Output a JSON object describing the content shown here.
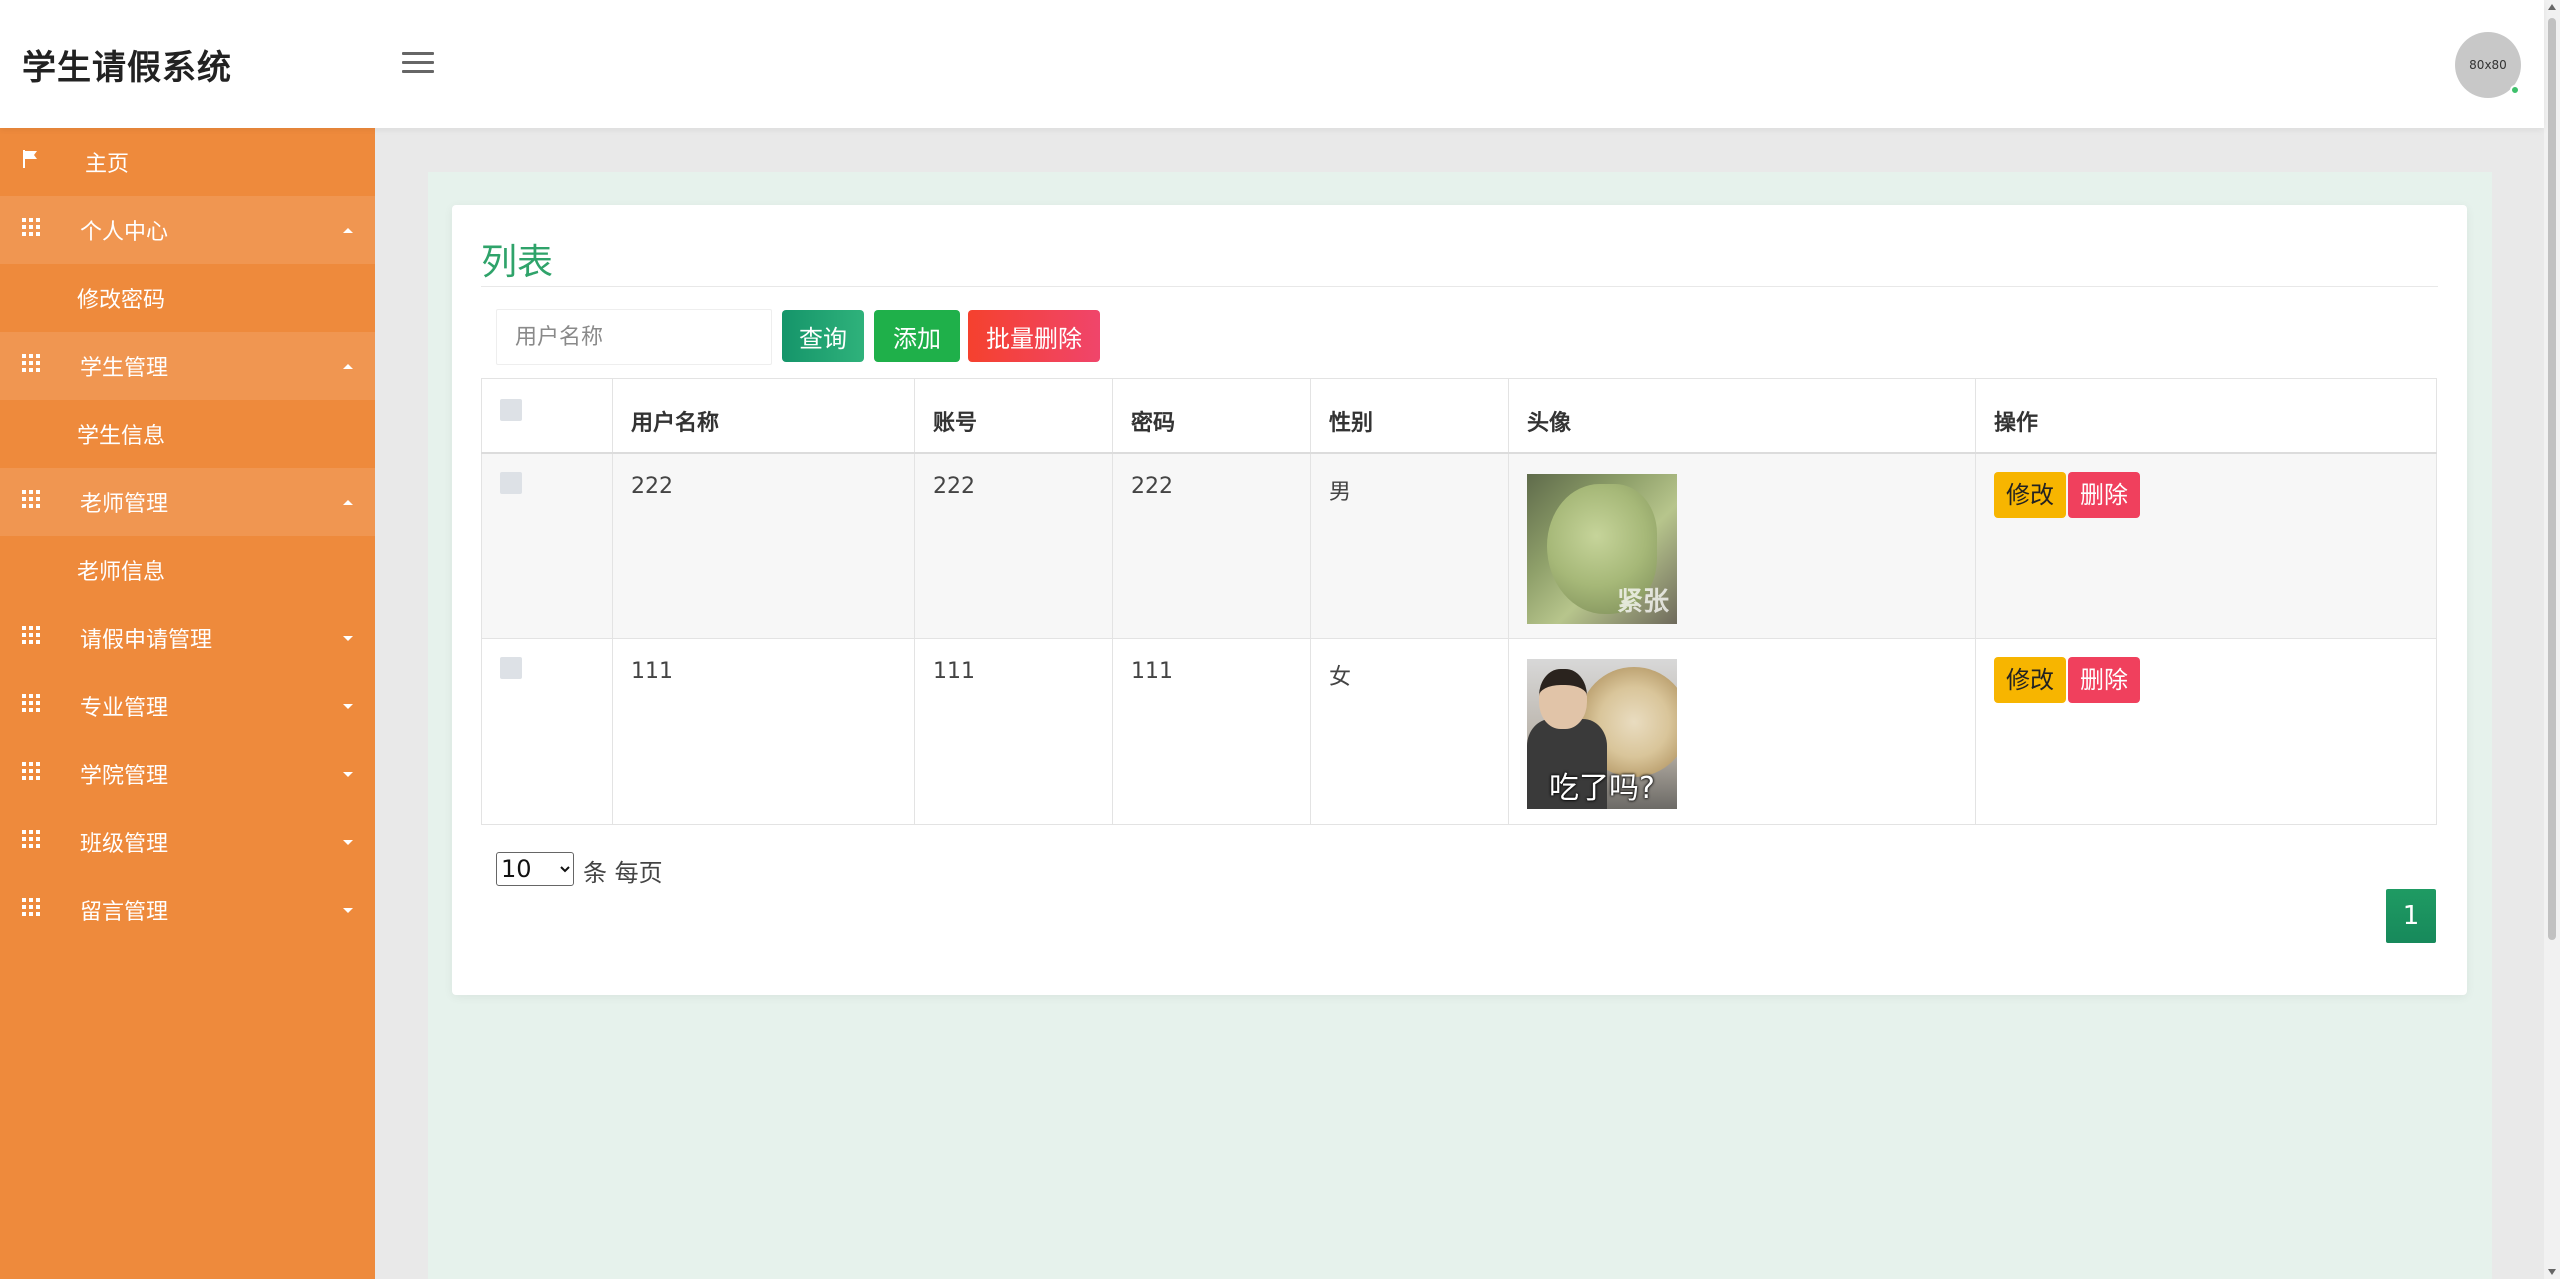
{
  "app": {
    "title": "学生请假系统",
    "avatar_text": "80x80"
  },
  "sidebar": {
    "home": "主页",
    "groups": [
      {
        "label": "个人中心",
        "expanded": true,
        "children": [
          "修改密码"
        ]
      },
      {
        "label": "学生管理",
        "expanded": true,
        "children": [
          "学生信息"
        ]
      },
      {
        "label": "老师管理",
        "expanded": true,
        "children": [
          "老师信息"
        ]
      },
      {
        "label": "请假申请管理",
        "expanded": false,
        "children": []
      },
      {
        "label": "专业管理",
        "expanded": false,
        "children": []
      },
      {
        "label": "学院管理",
        "expanded": false,
        "children": []
      },
      {
        "label": "班级管理",
        "expanded": false,
        "children": []
      },
      {
        "label": "留言管理",
        "expanded": false,
        "children": []
      }
    ]
  },
  "panel": {
    "title": "列表"
  },
  "toolbar": {
    "search_placeholder": "用户名称",
    "query_label": "查询",
    "add_label": "添加",
    "batch_delete_label": "批量删除"
  },
  "table": {
    "columns": [
      "用户名称",
      "账号",
      "密码",
      "性别",
      "头像",
      "操作"
    ],
    "rows": [
      {
        "username": "222",
        "account": "222",
        "password": "222",
        "gender": "男",
        "avatar_caption": "紧张"
      },
      {
        "username": "111",
        "account": "111",
        "password": "111",
        "gender": "女",
        "avatar_caption": "吃了吗?"
      }
    ],
    "edit_label": "修改",
    "delete_label": "删除"
  },
  "pagination": {
    "page_size": "10",
    "page_size_options": [
      "10"
    ],
    "per_page_label": "条 每页",
    "current_page": "1"
  },
  "colors": {
    "sidebar": "#ee8a3c",
    "accent_green": "#2fa36a",
    "edit": "#f7b500",
    "delete": "#f0405d"
  }
}
